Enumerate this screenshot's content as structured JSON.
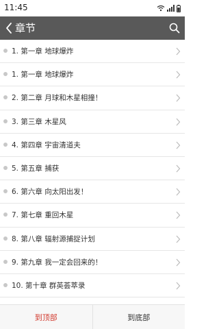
{
  "status_bar": {
    "time": "11:45",
    "icons": [
      "wifi-icon",
      "signal-icon",
      "battery-icon"
    ]
  },
  "app_bar": {
    "title": "章节",
    "back_icon": "back-icon",
    "search_icon": "search-icon",
    "background": "#595959"
  },
  "chapters": [
    {
      "label": "1. 第一章 地球爆炸"
    },
    {
      "label": "1. 第一章 地球爆炸"
    },
    {
      "label": "2. 第二章 月球和木星相撞！"
    },
    {
      "label": "3. 第三章 木星风"
    },
    {
      "label": "4. 第四章 宇宙清道夫"
    },
    {
      "label": "5. 第五章 捕获"
    },
    {
      "label": "6. 第六章 向太阳出发！"
    },
    {
      "label": "7. 第七章 重回木星"
    },
    {
      "label": "8. 第八章 辐射源捕捉计划"
    },
    {
      "label": "9. 第九章 我一定会回来的！"
    },
    {
      "label": "10. 第十章 群英荟萃录"
    }
  ],
  "bottom_bar": {
    "to_top": "到顶部",
    "to_bottom": "到底部",
    "accent": "#d23b2f"
  }
}
